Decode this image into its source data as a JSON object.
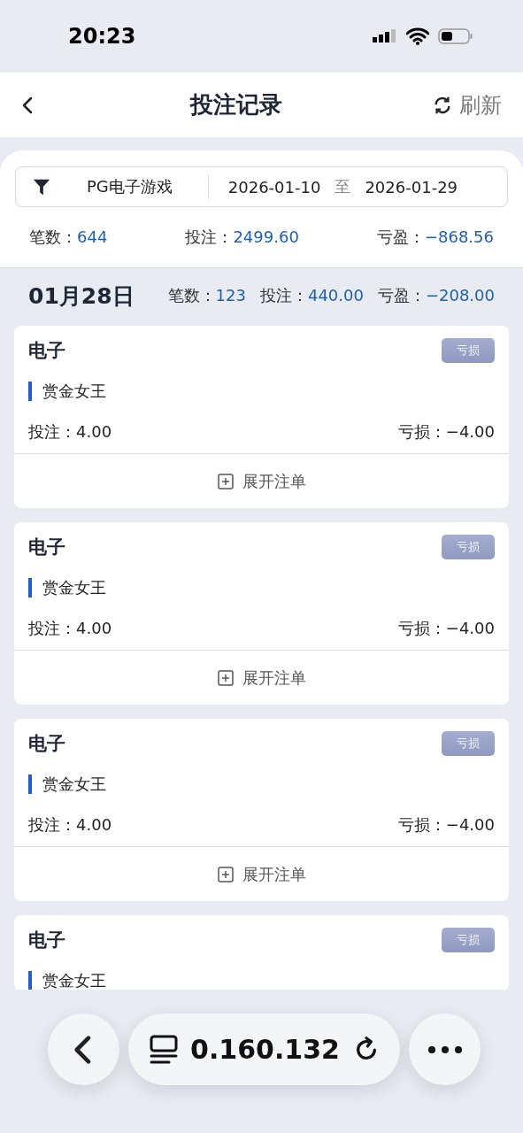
{
  "status_bar": {
    "time": "20:23"
  },
  "header": {
    "title": "投注记录",
    "refresh": "刷新"
  },
  "filter": {
    "game": "PG电子游戏",
    "date_from": "2026-01-10",
    "separator": "至",
    "date_to": "2026-01-29"
  },
  "summary": [
    {
      "label": "笔数：",
      "value": "644"
    },
    {
      "label": "投注：",
      "value": "2499.60"
    },
    {
      "label": "亏盈：",
      "value": "−868.56"
    }
  ],
  "day": {
    "date": "01月28日",
    "stats": [
      {
        "label": "笔数：",
        "value": "123"
      },
      {
        "label": "投注：",
        "value": "440.00"
      },
      {
        "label": "亏盈：",
        "value": "−208.00"
      }
    ]
  },
  "records": [
    {
      "category": "电子",
      "tag": "亏损",
      "game": "赏金女王",
      "bet": "投注：4.00",
      "result": "亏损：−4.00",
      "expand": "展开注单"
    },
    {
      "category": "电子",
      "tag": "亏损",
      "game": "赏金女王",
      "bet": "投注：4.00",
      "result": "亏损：−4.00",
      "expand": "展开注单"
    },
    {
      "category": "电子",
      "tag": "亏损",
      "game": "赏金女王",
      "bet": "投注：4.00",
      "result": "亏损：−4.00",
      "expand": "展开注单"
    },
    {
      "category": "电子",
      "tag": "亏损",
      "game": "赏金女王"
    }
  ],
  "browser_bar": {
    "address": "0.160.132"
  }
}
